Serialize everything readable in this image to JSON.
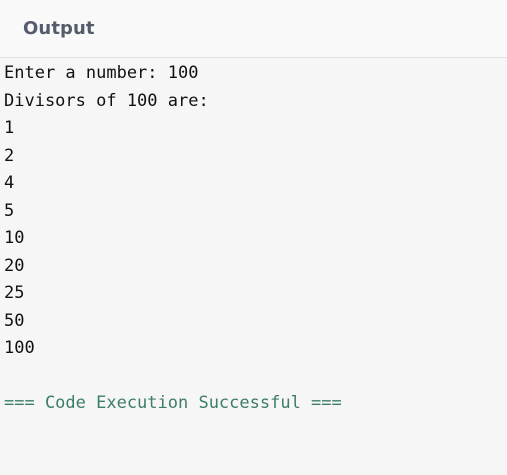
{
  "header": {
    "title": "Output"
  },
  "console": {
    "prompt_line": "Enter a number: 100",
    "heading_line": "Divisors of 100 are:",
    "divisors": [
      "1",
      "2",
      "4",
      "5",
      "10",
      "20",
      "25",
      "50",
      "100"
    ],
    "blank_line": "",
    "status_line": "=== Code Execution Successful ===",
    "status_color": "#3b7e64"
  }
}
